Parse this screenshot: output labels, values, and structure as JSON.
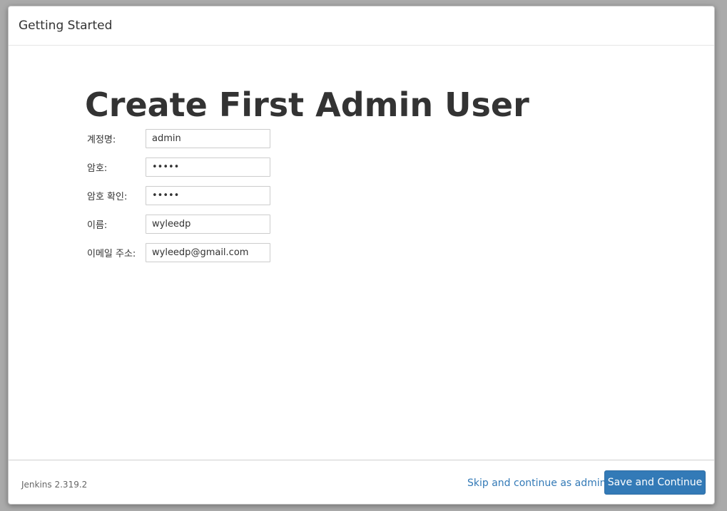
{
  "header": {
    "title": "Getting Started"
  },
  "main": {
    "heading": "Create First Admin User",
    "fields": [
      {
        "label": "계정명:",
        "value": "admin",
        "type": "text"
      },
      {
        "label": "암호:",
        "value": "admin",
        "type": "password"
      },
      {
        "label": "암호 확인:",
        "value": "admin",
        "type": "password"
      },
      {
        "label": "이름:",
        "value": "wyleedp",
        "type": "text"
      },
      {
        "label": "이메일 주소:",
        "value": "wyleedp@gmail.com",
        "type": "text"
      }
    ]
  },
  "footer": {
    "version": "Jenkins 2.319.2",
    "skip_label": "Skip and continue as admin",
    "save_label": "Save and Continue"
  },
  "colors": {
    "primary": "#337ab7",
    "text": "#333333"
  }
}
